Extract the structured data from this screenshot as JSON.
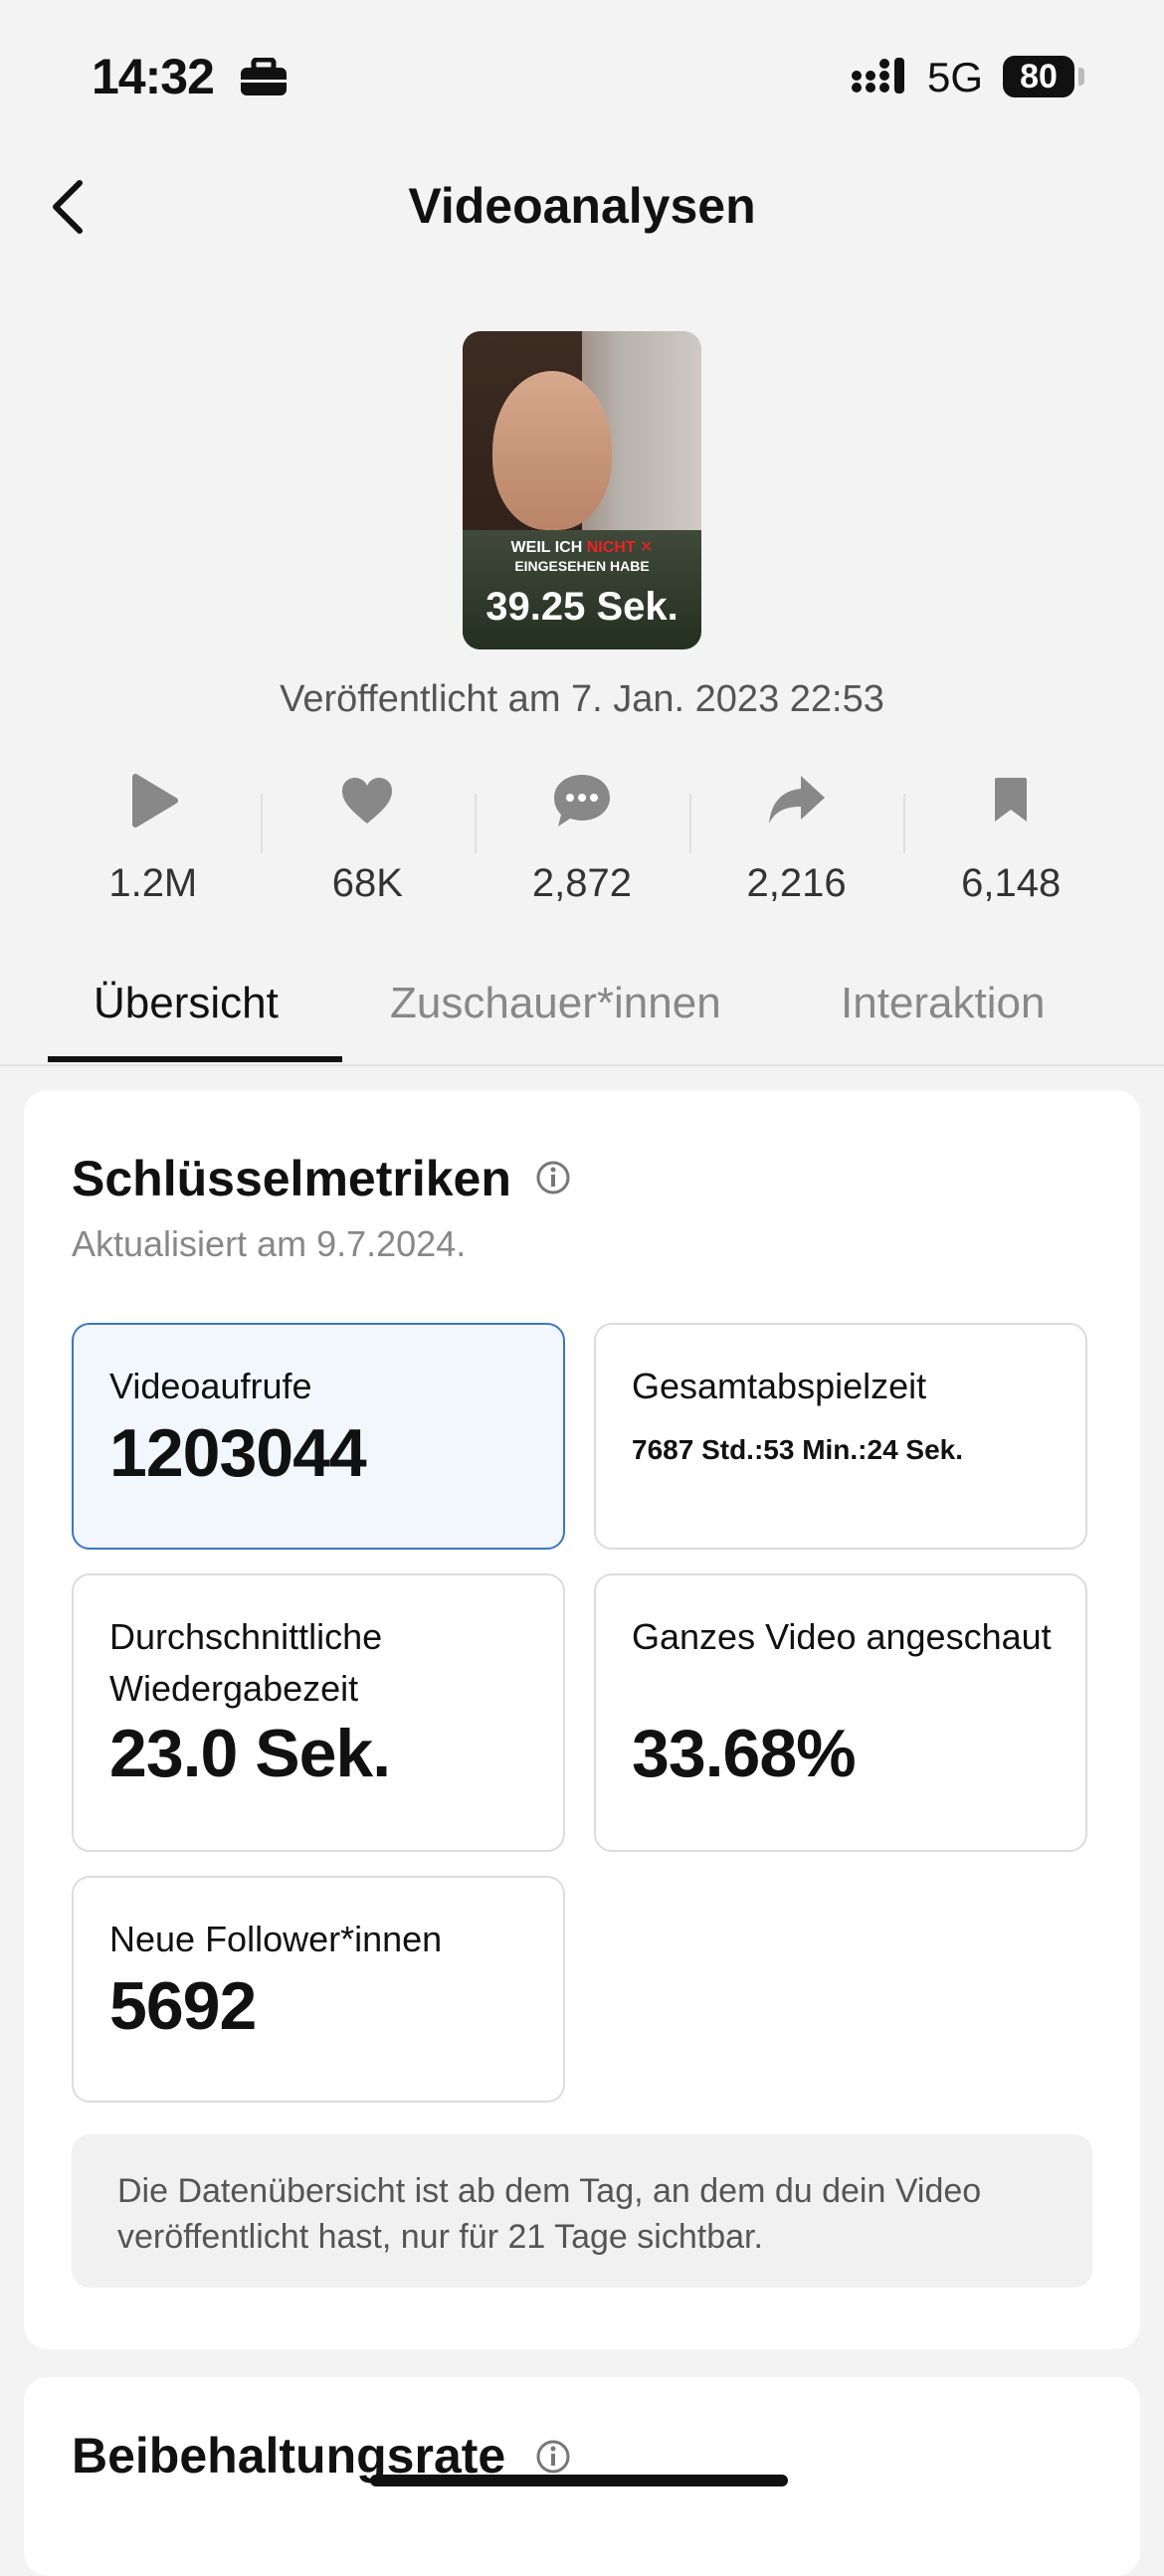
{
  "status_bar": {
    "time": "14:32",
    "network": "5G",
    "battery": "80"
  },
  "header": {
    "title": "Videoanalysen"
  },
  "video": {
    "caption_line1_a": "WEIL ICH ",
    "caption_line1_b": "NICHT",
    "caption_line2": "EINGESEHEN HABE",
    "duration": "39.25 Sek.",
    "published": "Veröffentlicht am 7. Jan. 2023 22:53"
  },
  "stats": [
    {
      "icon": "play-icon",
      "value": "1.2M"
    },
    {
      "icon": "heart-icon",
      "value": "68K"
    },
    {
      "icon": "comment-icon",
      "value": "2,872"
    },
    {
      "icon": "share-icon",
      "value": "2,216"
    },
    {
      "icon": "bookmark-icon",
      "value": "6,148"
    }
  ],
  "tabs": [
    {
      "label": "Übersicht",
      "active": true
    },
    {
      "label": "Zuschauer*innen",
      "active": false
    },
    {
      "label": "Interaktion",
      "active": false
    }
  ],
  "key_metrics": {
    "title": "Schlüsselmetriken",
    "updated": "Aktualisiert am 9.7.2024.",
    "items": [
      {
        "label": "Videoaufrufe",
        "value": "1203044"
      },
      {
        "label": "Gesamtabspielzeit",
        "value": "7687 Std.:53 Min.:24 Sek."
      },
      {
        "label": "Durchschnittliche Wiedergabezeit",
        "value": "23.0 Sek."
      },
      {
        "label": "Ganzes Video angeschaut",
        "value": "33.68%"
      },
      {
        "label": "Neue Follower*innen",
        "value": "5692"
      }
    ],
    "note": "Die Datenübersicht ist ab dem Tag, an dem du dein Video veröffentlicht hast, nur für 21 Tage sichtbar."
  },
  "retention": {
    "title": "Beibehaltungsrate"
  },
  "colors": {
    "selected_border": "#3a76c4",
    "selected_bg": "#f2f7fd",
    "background": "#f3f3f3"
  }
}
